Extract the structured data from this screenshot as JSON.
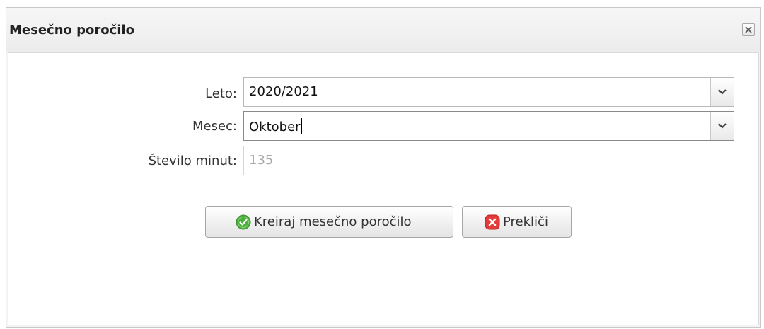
{
  "dialog": {
    "title": "Mesečno poročilo"
  },
  "form": {
    "year": {
      "label": "Leto:",
      "value": "2020/2021"
    },
    "month": {
      "label": "Mesec:",
      "value": "Oktober"
    },
    "minutes": {
      "label": "Število minut:",
      "value": "135"
    }
  },
  "buttons": {
    "create_label": "Kreiraj mesečno poročilo",
    "cancel_label": "Prekliči"
  },
  "colors": {
    "ok_icon": "#4caf3d",
    "cancel_icon": "#e53a3a"
  }
}
